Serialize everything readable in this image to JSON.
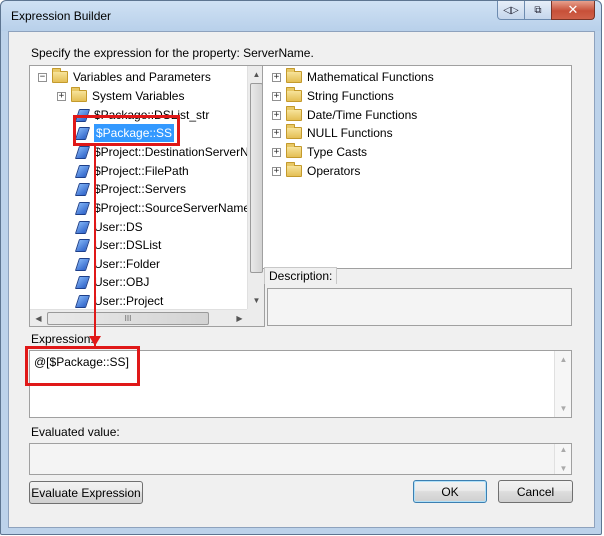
{
  "window": {
    "title": "Expression Builder",
    "caption_buttons": {
      "back_icon": "◁▷",
      "restore_icon": "⧉",
      "close_icon": "✕"
    }
  },
  "prompt_text": "Specify the expression for the property: ServerName.",
  "variables_tree": {
    "root": {
      "label": "Variables and Parameters",
      "expander": "−"
    },
    "system": {
      "label": "System Variables",
      "expander": "+"
    },
    "items": [
      {
        "label": "$Package::DSList_str",
        "selected": false
      },
      {
        "label": "$Package::SS",
        "selected": true
      },
      {
        "label": "$Project::DestinationServerNa",
        "selected": false
      },
      {
        "label": "$Project::FilePath",
        "selected": false
      },
      {
        "label": "$Project::Servers",
        "selected": false
      },
      {
        "label": "$Project::SourceServerName",
        "selected": false
      },
      {
        "label": "User::DS",
        "selected": false
      },
      {
        "label": "User::DSList",
        "selected": false
      },
      {
        "label": "User::Folder",
        "selected": false
      },
      {
        "label": "User::OBJ",
        "selected": false
      },
      {
        "label": "User::Project",
        "selected": false
      }
    ],
    "hscroll_grip": "III"
  },
  "functions_tree": {
    "items": [
      {
        "label": "Mathematical Functions",
        "expander": "+"
      },
      {
        "label": "String Functions",
        "expander": "+"
      },
      {
        "label": "Date/Time Functions",
        "expander": "+"
      },
      {
        "label": "NULL Functions",
        "expander": "+"
      },
      {
        "label": "Type Casts",
        "expander": "+"
      },
      {
        "label": "Operators",
        "expander": "+"
      }
    ]
  },
  "description_label": "Description:",
  "expression": {
    "label": "Expression:",
    "value": "@[$Package::SS]"
  },
  "evaluated": {
    "label": "Evaluated value:",
    "value": ""
  },
  "buttons": {
    "evaluate": "Evaluate Expression",
    "ok": "OK",
    "cancel": "Cancel"
  },
  "annotation_color": "#e01818",
  "selection_color": "#3399ff"
}
